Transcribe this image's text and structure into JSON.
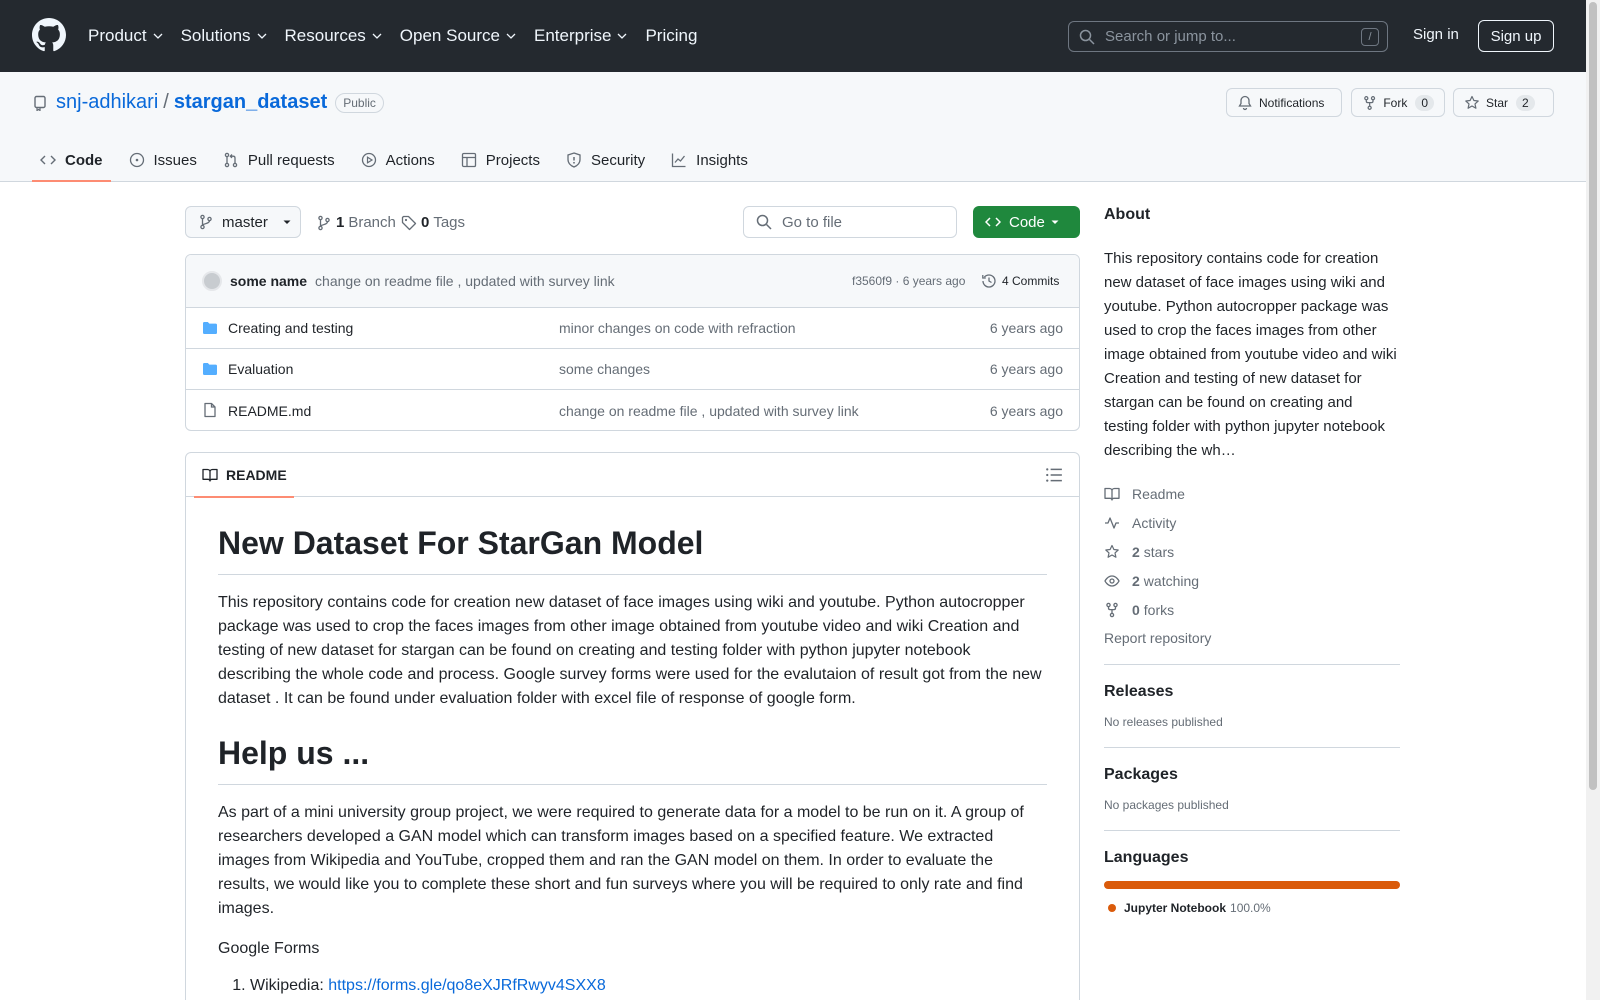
{
  "topnav": {
    "items": [
      "Product",
      "Solutions",
      "Resources",
      "Open Source",
      "Enterprise",
      "Pricing"
    ],
    "search_placeholder": "Search or jump to...",
    "search_shortcut": "/",
    "sign_in": "Sign in",
    "sign_up": "Sign up"
  },
  "repo": {
    "owner": "snj-adhikari",
    "separator": "/",
    "name": "stargan_dataset",
    "visibility": "Public",
    "notifications_label": "Notifications",
    "fork_label": "Fork",
    "fork_count": "0",
    "star_label": "Star",
    "star_count": "2",
    "tabs": [
      "Code",
      "Issues",
      "Pull requests",
      "Actions",
      "Projects",
      "Security",
      "Insights"
    ]
  },
  "toolbar": {
    "branch": "master",
    "branch_count": "1",
    "branch_label": "Branch",
    "tag_count": "0",
    "tag_label": "Tags",
    "goto_placeholder": "Go to file",
    "code_button": "Code"
  },
  "commit": {
    "author": "some name",
    "message": "change on readme file , updated with survey link",
    "meta": "f3560f9 · 6 years ago",
    "count_label": "4 Commits"
  },
  "files": [
    {
      "name": "Creating and testing",
      "type": "folder",
      "message": "minor changes on code with refraction",
      "age": "6 years ago"
    },
    {
      "name": "Evaluation",
      "type": "folder",
      "message": "some changes",
      "age": "6 years ago"
    },
    {
      "name": "README.md",
      "type": "file",
      "message": "change on readme file , updated with survey link",
      "age": "6 years ago"
    }
  ],
  "readme": {
    "tab_label": "README",
    "h1": "New Dataset For StarGan Model",
    "p1": "This repository contains code for creation new dataset of face images using wiki and youtube. Python autocropper package was used to crop the faces images from other image obtained from youtube video and wiki Creation and testing of new dataset for stargan can be found on creating and testing folder with python jupyter notebook describing the whole code and process. Google survey forms were used for the evalutaion of result got from the new dataset . It can be found under evaluation folder with excel file of response of google form.",
    "h2": "Help us ...",
    "p2": "As part of a mini university group project, we were required to generate data for a model to be run on it. A group of researchers developed a GAN model which can transform images based on a specified feature. We extracted images from Wikipedia and YouTube, cropped them and ran the GAN model on them. In order to evaluate the results, we would like you to complete these short and fun surveys where you will be required to only rate and find images.",
    "p3": "Google Forms",
    "list_label": "Wikipedia:",
    "list_link": "https://forms.gle/qo8eXJRfRwyv4SXX8"
  },
  "sidebar": {
    "about_title": "About",
    "about_text": "This repository contains code for creation new dataset of face images using wiki and youtube. Python autocropper package was used to crop the faces images from other image obtained from youtube video and wiki Creation and testing of new dataset for stargan can be found on creating and testing folder with python jupyter notebook describing the wh…",
    "readme": "Readme",
    "activity": "Activity",
    "stars_count": "2",
    "stars_label": "stars",
    "watching_count": "2",
    "watching_label": "watching",
    "forks_count": "0",
    "forks_label": "forks",
    "report": "Report repository",
    "releases_title": "Releases",
    "releases_text": "No releases published",
    "packages_title": "Packages",
    "packages_text": "No packages published",
    "languages_title": "Languages",
    "language_name": "Jupyter Notebook",
    "language_pct": "100.0%",
    "language_color": "#DA5B0B"
  }
}
